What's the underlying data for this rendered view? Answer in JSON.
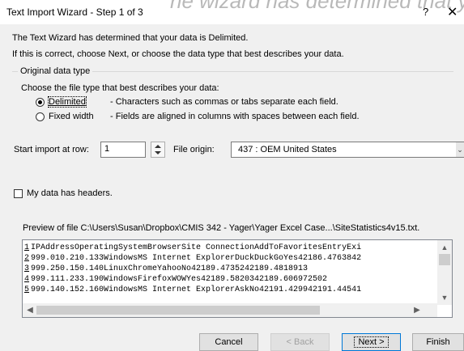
{
  "window": {
    "title": "Text Import Wizard - Step 1 of 3",
    "help_label": "?",
    "close_label": "✕",
    "overlay_text": "he wizard has determined that your data"
  },
  "intro": {
    "line1": "The Text Wizard has determined that your data is Delimited.",
    "line2": "If this is correct, choose Next, or choose the data type that best describes your data."
  },
  "original_data_type": {
    "legend": "Original data type",
    "prompt": "Choose the file type that best describes your data:",
    "options": [
      {
        "label": "Delimited",
        "hint": "- Characters such as commas or tabs separate each field.",
        "selected": true
      },
      {
        "label": "Fixed width",
        "hint": "- Fields are aligned in columns with spaces between each field.",
        "selected": false
      }
    ]
  },
  "start_import": {
    "label": "Start import at row:",
    "value": "1"
  },
  "file_origin": {
    "label": "File origin:",
    "value": "437 : OEM United States"
  },
  "headers_checkbox": {
    "label": "My data has headers.",
    "checked": false
  },
  "preview": {
    "label": "Preview of file C:\\Users\\Susan\\Dropbox\\CMIS 342 - Yager\\Yager Excel Case...\\SiteStatistics4v15.txt.",
    "lines": [
      {
        "num": "1",
        "text": "IPAddressOperatingSystemBrowserSite ConnectionAddToFavoritesEntryExi"
      },
      {
        "num": "2",
        "text": "999.010.210.133WindowsMS Internet ExplorerDuckDuckGoYes42186.4763842"
      },
      {
        "num": "3",
        "text": "999.250.150.140LinuxChromeYahooNo42189.4735242189.4818913"
      },
      {
        "num": "4",
        "text": "999.111.233.190WindowsFirefoxWOWYes42189.5820342189.606972502"
      },
      {
        "num": "5",
        "text": "999.140.152.160WindowsMS Internet ExplorerAskNo42191.429942191.44541"
      }
    ]
  },
  "buttons": {
    "cancel": "Cancel",
    "back": "< Back",
    "next": "Next >",
    "finish": "Finish"
  },
  "icons": {
    "spinner": "spin-up-down-icon",
    "dropdown": "chevron-down-icon",
    "scroll": "scroll-arrow-icon"
  }
}
